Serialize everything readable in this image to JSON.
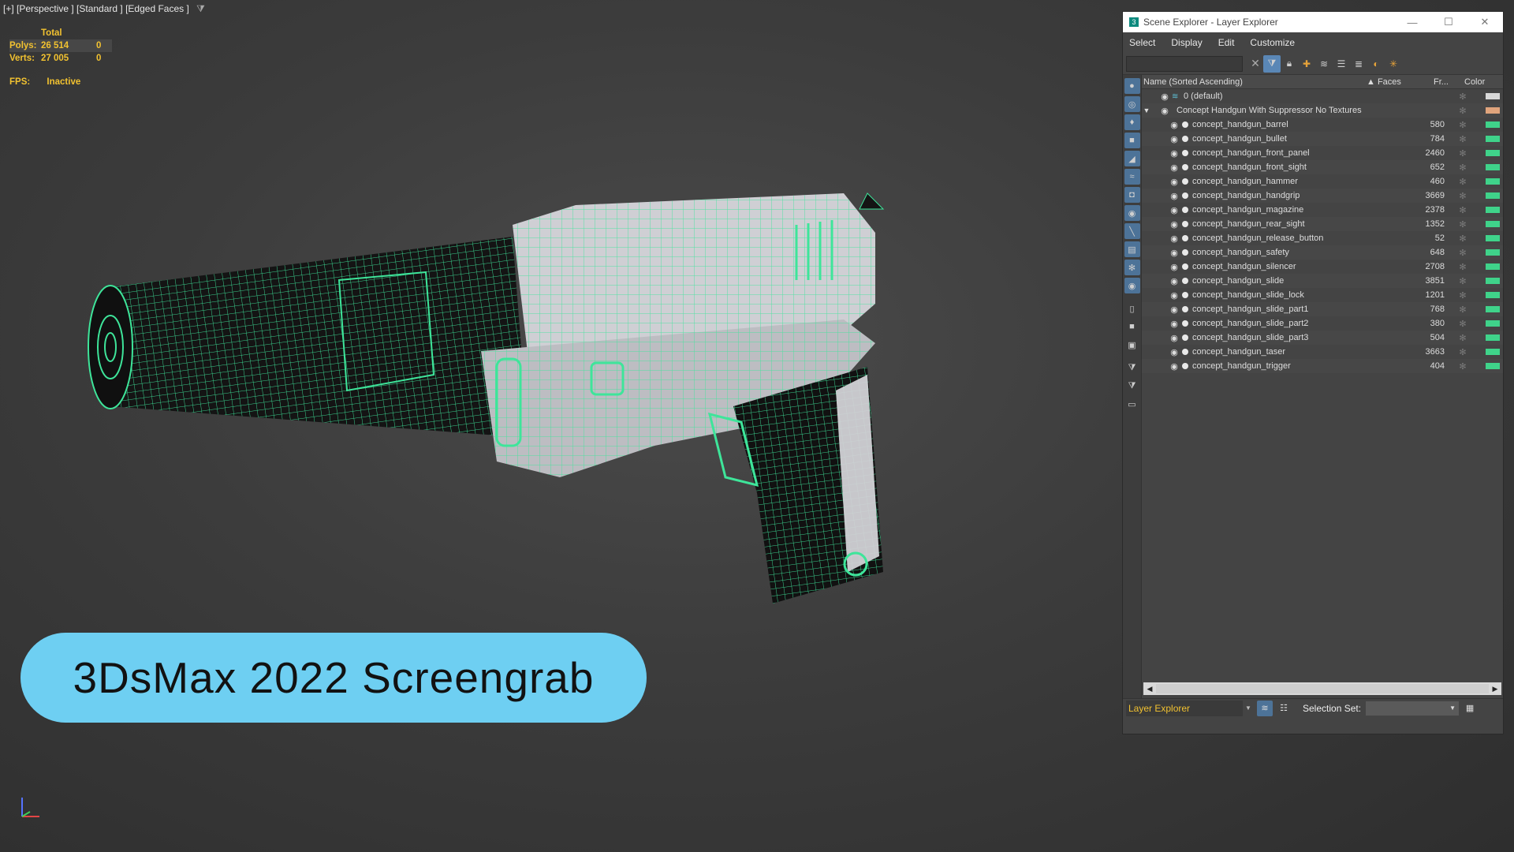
{
  "viewport": {
    "label": "[+] [Perspective ] [Standard ] [Edged Faces ]",
    "stats": {
      "header": "Total",
      "polys_label": "Polys:",
      "polys_value": "26 514",
      "polys_sel": "0",
      "verts_label": "Verts:",
      "verts_value": "27 005",
      "verts_sel": "0"
    },
    "fps_label": "FPS:",
    "fps_value": "Inactive"
  },
  "badge": {
    "text": "3DsMax 2022 Screengrab"
  },
  "explorer": {
    "title": "Scene Explorer - Layer Explorer",
    "menu": [
      "Select",
      "Display",
      "Edit",
      "Customize"
    ],
    "columns": {
      "name": "Name (Sorted Ascending)",
      "faces": "▲ Faces",
      "frozen": "Fr...",
      "color": "Color"
    },
    "default_layer": {
      "name": "0 (default)",
      "color": "#d8d8d8"
    },
    "group": {
      "name": "Concept Handgun With Suppressor No Textures",
      "color": "#e0a47c"
    },
    "object_color": "#3fd38a",
    "objects": [
      {
        "name": "concept_handgun_barrel",
        "faces": "580"
      },
      {
        "name": "concept_handgun_bullet",
        "faces": "784"
      },
      {
        "name": "concept_handgun_front_panel",
        "faces": "2460"
      },
      {
        "name": "concept_handgun_front_sight",
        "faces": "652"
      },
      {
        "name": "concept_handgun_hammer",
        "faces": "460"
      },
      {
        "name": "concept_handgun_handgrip",
        "faces": "3669"
      },
      {
        "name": "concept_handgun_magazine",
        "faces": "2378"
      },
      {
        "name": "concept_handgun_rear_sight",
        "faces": "1352"
      },
      {
        "name": "concept_handgun_release_button",
        "faces": "52"
      },
      {
        "name": "concept_handgun_safety",
        "faces": "648"
      },
      {
        "name": "concept_handgun_silencer",
        "faces": "2708"
      },
      {
        "name": "concept_handgun_slide",
        "faces": "3851"
      },
      {
        "name": "concept_handgun_slide_lock",
        "faces": "1201"
      },
      {
        "name": "concept_handgun_slide_part1",
        "faces": "768"
      },
      {
        "name": "concept_handgun_slide_part2",
        "faces": "380"
      },
      {
        "name": "concept_handgun_slide_part3",
        "faces": "504"
      },
      {
        "name": "concept_handgun_taser",
        "faces": "3663"
      },
      {
        "name": "concept_handgun_trigger",
        "faces": "404"
      }
    ],
    "footer": {
      "explorer_select": "Layer Explorer",
      "selection_set_label": "Selection Set:"
    }
  }
}
